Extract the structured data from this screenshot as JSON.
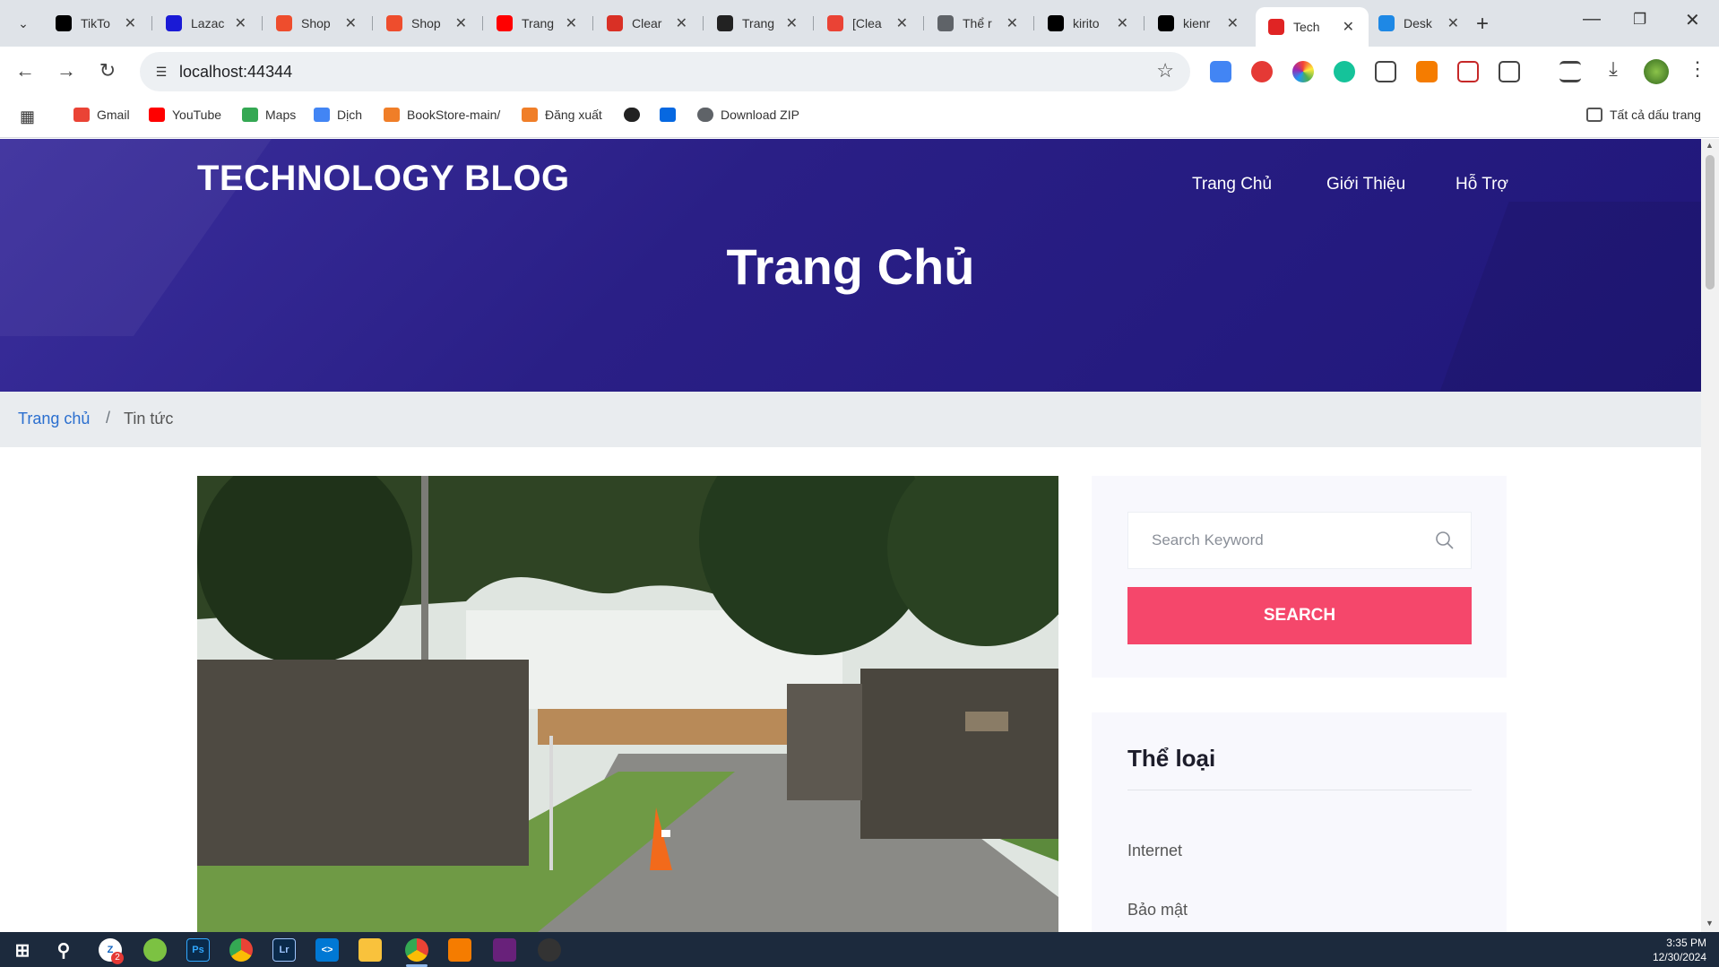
{
  "browser": {
    "tabs": [
      {
        "label": "TikTo",
        "icon": "tiktok-icon",
        "color": "#000000"
      },
      {
        "label": "Lazac",
        "icon": "lazada-icon",
        "color": "#1a1ad6"
      },
      {
        "label": "Shop",
        "icon": "shopee-icon",
        "color": "#ee4d2d"
      },
      {
        "label": "Shop",
        "icon": "shopee-icon",
        "color": "#ee4d2d"
      },
      {
        "label": "Trang",
        "icon": "youtube-icon",
        "color": "#ff0000"
      },
      {
        "label": "Clear",
        "icon": "clear-icon",
        "color": "#d93025"
      },
      {
        "label": "Trang",
        "icon": "openai-icon",
        "color": "#222222"
      },
      {
        "label": "[Clea",
        "icon": "gmail-icon",
        "color": "#ea4335"
      },
      {
        "label": "Thể r",
        "icon": "chrome-icon",
        "color": "#5f6368"
      },
      {
        "label": "kirito",
        "icon": "github-icon",
        "color": "#000000"
      },
      {
        "label": "kienr",
        "icon": "github-icon",
        "color": "#000000"
      },
      {
        "label": "Tech",
        "icon": "s-brand-icon",
        "color": "#e02424",
        "active": true
      },
      {
        "label": "Desk",
        "icon": "desk-icon",
        "color": "#1e88e5"
      }
    ],
    "url": "localhost:44344",
    "bookmarks": [
      {
        "label": "Gmail",
        "icon": "gmail-icon",
        "color": "#ea4335"
      },
      {
        "label": "YouTube",
        "icon": "youtube-icon",
        "color": "#ff0000"
      },
      {
        "label": "Maps",
        "icon": "maps-icon",
        "color": "#34a853"
      },
      {
        "label": "Dịch",
        "icon": "translate-icon",
        "color": "#4285f4"
      },
      {
        "label": "BookStore-main/",
        "icon": "xampp-icon",
        "color": "#f07e28"
      },
      {
        "label": "Đăng xuất",
        "icon": "xampp-icon",
        "color": "#f07e28"
      },
      {
        "label": "",
        "icon": "openai-icon",
        "color": "#222222"
      },
      {
        "label": "",
        "icon": "meta-icon",
        "color": "#0668e1"
      },
      {
        "label": "Download ZIP",
        "icon": "globe-icon",
        "color": "#5f6368"
      }
    ],
    "all_bookmarks": "Tất cả dấu trang"
  },
  "site": {
    "brand": "TECHNOLOGY BLOG",
    "nav": [
      "Trang Chủ",
      "Giới Thiệu",
      "Hỗ Trợ"
    ],
    "hero_title": "Trang Chủ",
    "breadcrumb": {
      "home": "Trang chủ",
      "separator": "/",
      "current": "Tin tức"
    },
    "search": {
      "placeholder": "Search Keyword",
      "button": "SEARCH"
    },
    "categories": {
      "title": "Thể loại",
      "items": [
        "Internet",
        "Bảo mật"
      ]
    },
    "colors": {
      "hero": "#2a1f86",
      "accent": "#f5476b",
      "link": "#2b6fcf"
    }
  },
  "taskbar": {
    "time": "3:35 PM",
    "date": "12/30/2024",
    "badge": "2"
  }
}
